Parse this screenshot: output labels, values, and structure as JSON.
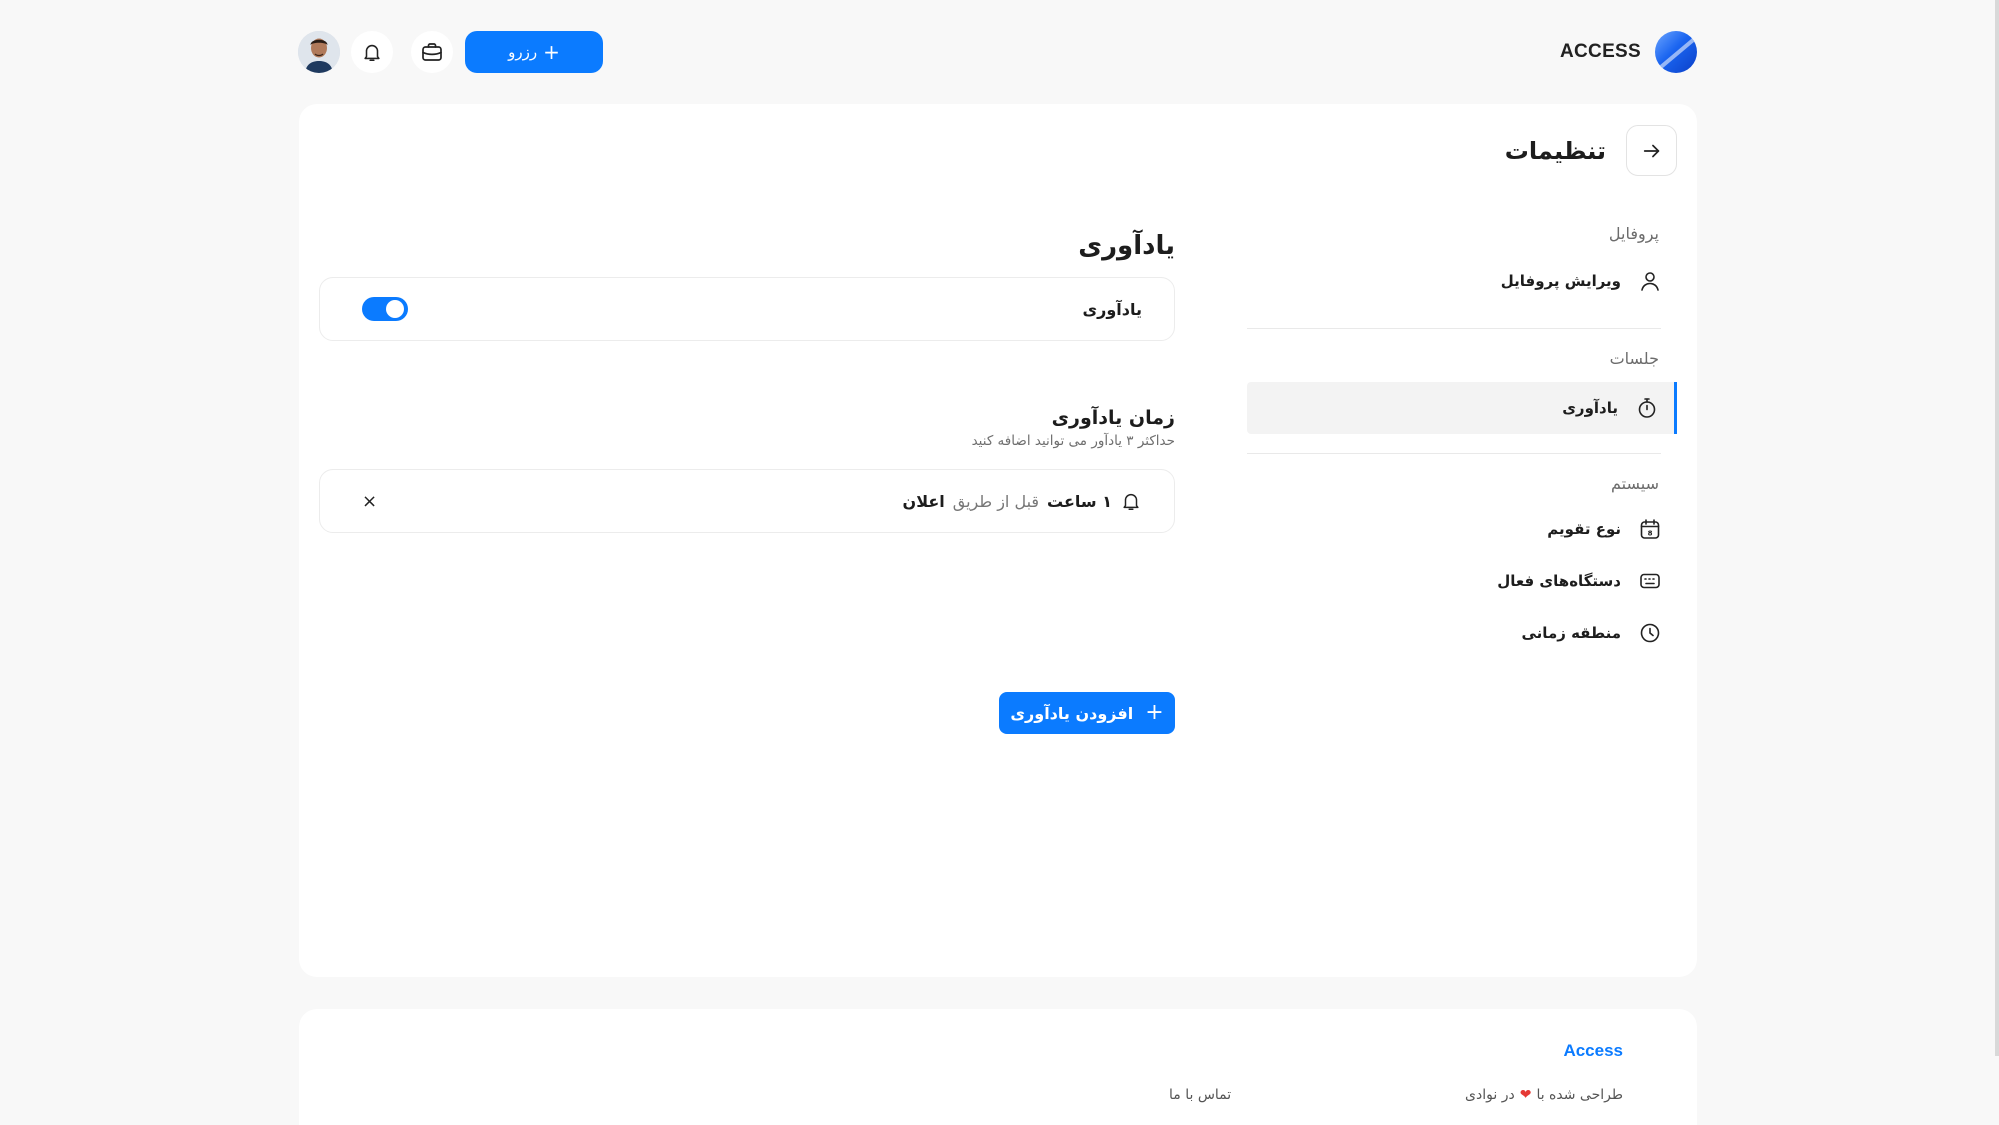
{
  "brand": {
    "name": "ACCESS",
    "logo_icon": "access-logo-icon"
  },
  "topbar": {
    "reserve_label": "رزرو",
    "reserve_icon": "plus-icon",
    "briefcase_icon": "briefcase-icon",
    "notification_icon": "bell-icon",
    "avatar_icon": "user-avatar"
  },
  "page": {
    "title": "تنظیمات",
    "back_icon": "arrow-right-icon"
  },
  "sidebar": {
    "groups": [
      {
        "label": "پروفایل",
        "items": [
          {
            "label": "ویرایش پروفایل",
            "icon": "user-icon"
          }
        ]
      },
      {
        "label": "جلسات",
        "items": [
          {
            "label": "یادآوری",
            "icon": "timer-icon",
            "active": true
          }
        ]
      },
      {
        "label": "سیستم",
        "items": [
          {
            "label": "نوع تقویم",
            "icon": "calendar-icon"
          },
          {
            "label": "دستگاه‌های فعال",
            "icon": "keyboard-icon"
          },
          {
            "label": "منطقه زمانی",
            "icon": "clock-icon"
          }
        ]
      }
    ]
  },
  "content": {
    "section_title": "یادآوری",
    "toggle_row": {
      "label": "یادآوری",
      "enabled": true
    },
    "reminder_time": {
      "title": "زمان یادآوری",
      "description": "حداکثر ۳ یادآور می توانید اضافه کنید",
      "items": [
        {
          "amount": "۱ ساعت",
          "mid": "قبل از طریق",
          "method": "اعلان",
          "icon": "bell-icon"
        }
      ],
      "remove_label": "×"
    },
    "add_button": {
      "label": "افزودن یادآوری",
      "icon": "plus-icon"
    }
  },
  "footer": {
    "brand": "Access",
    "made_prefix": "طراحی شده با",
    "made_suffix": "در نوادی",
    "heart": "❤",
    "contact": "تماس با ما"
  },
  "colors": {
    "accent": "#0b7bff",
    "background": "#f8f8f8",
    "card": "#ffffff"
  }
}
